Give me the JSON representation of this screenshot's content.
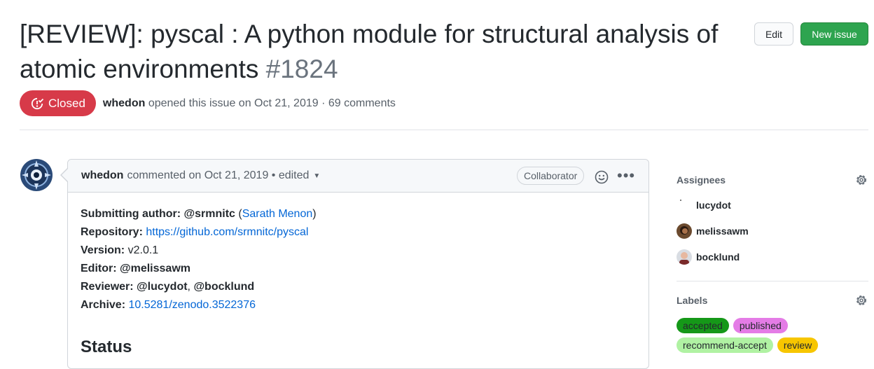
{
  "issue": {
    "title": "[REVIEW]: pyscal : A python module for structural analysis of atomic environments",
    "number": "#1824",
    "state": "Closed",
    "author": "whedon",
    "opened_text": "opened this issue on Oct 21, 2019 · 69 comments"
  },
  "header_buttons": {
    "edit": "Edit",
    "new_issue": "New issue"
  },
  "comment": {
    "author": "whedon",
    "meta": "commented on Oct 21, 2019 • edited",
    "role_badge": "Collaborator",
    "body": {
      "submitting_label": "Submitting author:",
      "submitting_handle": "@srmnitc",
      "submitting_open": " (",
      "submitting_name": "Sarath Menon",
      "submitting_close": ")",
      "repository_label": "Repository:",
      "repository_url": "https://github.com/srmnitc/pyscal",
      "version_label": "Version:",
      "version_value": "v2.0.1",
      "editor_label": "Editor:",
      "editor_value": "@melissawm",
      "reviewer_label": "Reviewer:",
      "reviewer_1": "@lucydot",
      "reviewer_sep": ", ",
      "reviewer_2": "@bocklund",
      "archive_label": "Archive:",
      "archive_value": "10.5281/zenodo.3522376",
      "status_heading": "Status"
    }
  },
  "sidebar": {
    "assignees_heading": "Assignees",
    "assignees": [
      "lucydot",
      "melissawm",
      "bocklund"
    ],
    "labels_heading": "Labels",
    "labels": [
      {
        "name": "accepted",
        "color": "#159818"
      },
      {
        "name": "published",
        "color": "#e47ce6"
      },
      {
        "name": "recommend-accept",
        "color": "#b0f2a3"
      },
      {
        "name": "review",
        "color": "#f7c600"
      }
    ]
  },
  "colors": {
    "closed_red": "#d73a49",
    "new_issue_green": "#2ea44f",
    "link_blue": "#0366d6"
  }
}
